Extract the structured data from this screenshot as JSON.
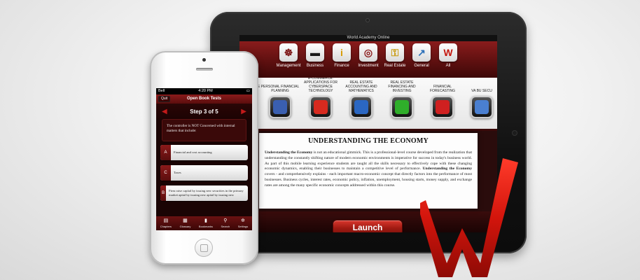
{
  "tablet": {
    "app_title": "World Academy Online",
    "categories": [
      {
        "label": "Management",
        "icon": "ship-wheel-icon",
        "glyph": "☸",
        "color": "#7a1010"
      },
      {
        "label": "Business",
        "icon": "credit-card-icon",
        "glyph": "▬",
        "color": "#1a1a1a"
      },
      {
        "label": "Finance",
        "icon": "info-icon",
        "glyph": "i",
        "color": "#d79a00"
      },
      {
        "label": "Investment",
        "icon": "target-icon",
        "glyph": "◎",
        "color": "#8a1a1a"
      },
      {
        "label": "Real Estate",
        "icon": "key-icon",
        "glyph": "⚿",
        "color": "#c89b12"
      },
      {
        "label": "General",
        "icon": "chart-icon",
        "glyph": "↗",
        "color": "#2a6fb8"
      },
      {
        "label": "All",
        "icon": "world-academy-logo-icon",
        "glyph": "W",
        "color": "#c4170e"
      }
    ],
    "courses": [
      {
        "label": "UNDERSTANDING THE ECONOMY",
        "icon": "economy-course-icon",
        "color": "#e3661b"
      },
      {
        "label": "PERSONAL FINANCIAL PLANNING",
        "icon": "planning-course-icon",
        "color": "#3a5fb0"
      },
      {
        "label": "E-COMMERCE: APPLICATIONS FOR CYBERSPACE TECHNOLOGY",
        "icon": "ecommerce-course-icon",
        "color": "#d72a1f"
      },
      {
        "label": "REAL ESTATE ACCOUNTING AND MATHEMATICS",
        "icon": "re-accounting-course-icon",
        "color": "#2b67c2"
      },
      {
        "label": "REAL ESTATE FINANCING AND INVESTING",
        "icon": "re-financing-course-icon",
        "color": "#2fae2a"
      },
      {
        "label": "FINANCIAL FORECASTING",
        "icon": "forecasting-course-icon",
        "color": "#cf2020"
      },
      {
        "label": "VA BU SECU",
        "icon": "securities-course-icon",
        "color": "#4a7fd0"
      }
    ],
    "course_title": "UNDERSTANDING THE ECONOMY",
    "description": {
      "lead_bold": "Understanding the Economy",
      "part1": " is not an educational gimmick. This is a professional-level course developed from the realization that understanding the constantly shifting nature of modern economic environments is imperative for success in today's business world. As part of this mobile learning experience students are taught all the skills necessary to effectively cope with these changing economic dynamics, enabling their businesses to maintain a competitive level of performance. ",
      "mid_bold": "Understanding the Economy",
      "part2": " covers - and comprehensively explains - each important macro-economic concept that directly factors into the performance of most businesses. Business cycles, interest rates, economic policy, inflation, unemployment, housing starts, money supply, and exchange rates are among the many specific economic concepts addressed within this course."
    },
    "launch_label": "Launch"
  },
  "phone": {
    "carrier": "Bell",
    "time": "4:20 PM",
    "battery": "▭",
    "quit_label": "Quit",
    "nav_title": "Open Book Tests",
    "step_text": "Step 3 of 5",
    "prev_arrow": "◀",
    "next_arrow": "▶",
    "question": "The controller is NOT Concerned with internal matters that include:",
    "answers": [
      {
        "letter": "A",
        "text": "Financial and cost accounting"
      },
      {
        "letter": "C",
        "text": "Taxes"
      },
      {
        "letter": "B",
        "text": "Firm raise capital by issuing new securities in the primary market apital by issuing new apital by issuing new"
      }
    ],
    "tabs": [
      {
        "label": "Chapters",
        "icon": "book-icon",
        "glyph": "▤"
      },
      {
        "label": "Glossary",
        "icon": "glossary-icon",
        "glyph": "▦"
      },
      {
        "label": "Bookmarks",
        "icon": "bookmark-icon",
        "glyph": "▮"
      },
      {
        "label": "Search",
        "icon": "search-icon",
        "glyph": "⚲"
      },
      {
        "label": "Settings",
        "icon": "gear-icon",
        "glyph": "✲"
      }
    ]
  },
  "colors": {
    "brand_red": "#c4170e",
    "dark_red": "#5a0d0d"
  }
}
